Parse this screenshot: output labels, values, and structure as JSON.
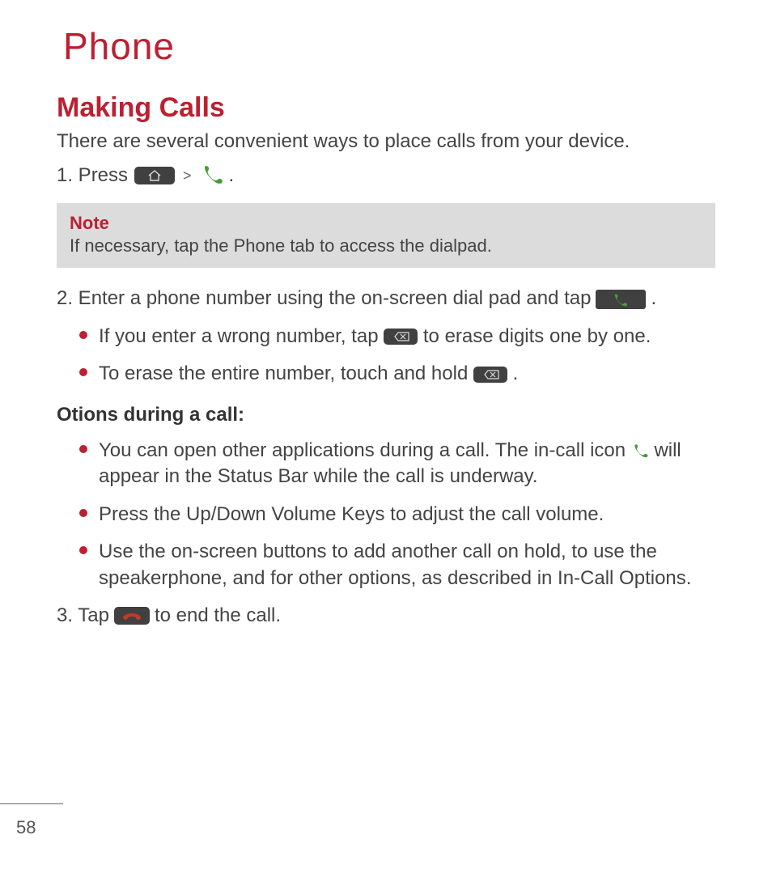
{
  "page": {
    "title": "Phone",
    "page_number": "58"
  },
  "section": {
    "heading": "Making Calls",
    "intro": "There are several convenient ways to place calls from your device.",
    "step1_a": "1. Press",
    "step1_sep": ">",
    "step1_end": ".",
    "note_label": "Note",
    "note_text": "If necessary, tap the Phone tab to access the dialpad.",
    "step2_a": "2. Enter a phone number using the on-screen dial pad and tap",
    "step2_end": ".",
    "sub2_a1": "If you enter a wrong number, tap",
    "sub2_a2": "to erase digits one by one.",
    "sub2_b1": "To erase the entire number, touch and hold",
    "sub2_b_end": ".",
    "options_heading": "Otions during a call:",
    "opt_a1": "You can open other applications during a call. The in-call icon",
    "opt_a2": "will appear in the Status Bar while the call is underway.",
    "opt_b": "Press the Up/Down Volume Keys to adjust the call volume.",
    "opt_c": "Use the on-screen buttons to add another call on hold, to use the speakerphone, and for other options, as described in In-Call Options.",
    "step3_a": "3. Tap",
    "step3_b": "to end the call."
  }
}
